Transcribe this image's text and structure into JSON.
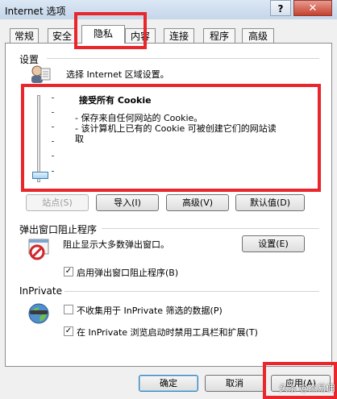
{
  "window": {
    "title": "Internet 选项",
    "help": "?",
    "close": "✕"
  },
  "tabs": [
    "常规",
    "安全",
    "隐私",
    "内容",
    "连接",
    "程序",
    "高级"
  ],
  "settings": {
    "group": "设置",
    "prompt": "选择 Internet 区域设置。",
    "level_title": "接受所有 Cookie",
    "level_desc_1": "- 保存来自任何网站的 Cookie。",
    "level_desc_2a": "- 该计算机上已有的 Cookie 可被创建它们的网站读",
    "level_desc_2b": "取",
    "slider_level": 0,
    "buttons": {
      "sites": "站点(S)",
      "import": "导入(I)",
      "advanced": "高级(V)",
      "default": "默认值(D)"
    }
  },
  "popup": {
    "group": "弹出窗口阻止程序",
    "desc": "阻止显示大多数弹出窗口。",
    "settings_btn": "设置(E)",
    "enable_label": "启用弹出窗口阻止程序(B)",
    "enable_checked": true
  },
  "inprivate": {
    "group": "InPrivate",
    "opt1_label": "不收集用于 InPrivate 筛选的数据(P)",
    "opt1_checked": false,
    "opt2_label": "在 InPrivate 浏览启动时禁用工具栏和扩展(T)",
    "opt2_checked": true
  },
  "footer": {
    "ok": "确定",
    "cancel": "取消",
    "apply": "应用(A)"
  },
  "watermark": "头条 @杰易佣",
  "colors": {
    "highlight": "#e8262c",
    "accent": "#3c7fb1"
  }
}
